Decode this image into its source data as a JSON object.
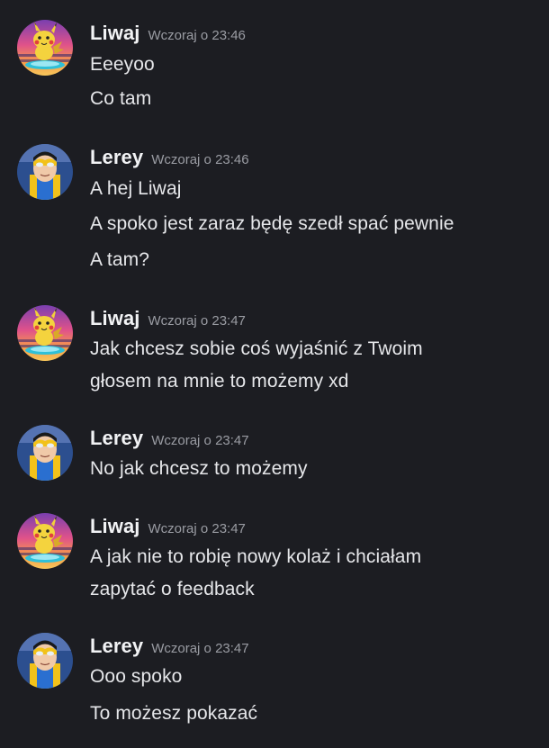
{
  "messages": [
    {
      "author": "Liwaj",
      "timestamp": "Wczoraj o 23:46",
      "avatar": "pikachu-avatar-icon",
      "lines": [
        "Eeeyoo",
        "Co tam"
      ]
    },
    {
      "author": "Lerey",
      "timestamp": "Wczoraj o 23:46",
      "avatar": "invincible-avatar-icon",
      "lines": [
        "A hej Liwaj",
        "A spoko jest zaraz będę szedł spać pewnie",
        "A tam?"
      ]
    },
    {
      "author": "Liwaj",
      "timestamp": "Wczoraj o 23:47",
      "avatar": "pikachu-avatar-icon",
      "lines": [
        "Jak chcesz sobie coś wyjaśnić z Twoim",
        "głosem na mnie to możemy xd"
      ]
    },
    {
      "author": "Lerey",
      "timestamp": "Wczoraj o 23:47",
      "avatar": "invincible-avatar-icon",
      "lines": [
        "No jak chcesz to możemy"
      ]
    },
    {
      "author": "Liwaj",
      "timestamp": "Wczoraj o 23:47",
      "avatar": "pikachu-avatar-icon",
      "lines": [
        "A jak nie to robię nowy kolaż i chciałam",
        "zapytać o feedback"
      ]
    },
    {
      "author": "Lerey",
      "timestamp": "Wczoraj o 23:47",
      "avatar": "invincible-avatar-icon",
      "lines": [
        "Ooo spoko",
        "To możesz pokazać"
      ]
    }
  ],
  "colors": {
    "background": "#1c1d22",
    "username": "#f2f3f5",
    "timestamp": "#9a9ca3",
    "text": "#e6e7ea"
  }
}
